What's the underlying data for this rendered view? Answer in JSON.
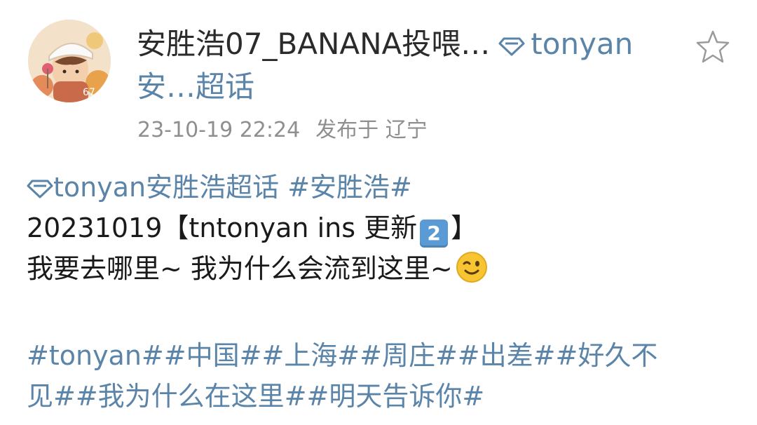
{
  "post": {
    "author_name": "安胜浩07_BANANA投喂…",
    "topic_inline": "tonyan",
    "topic_line2": "安…超话",
    "timestamp": "23-10-19 22:24",
    "location": "发布于 辽宁",
    "supertopic_link": "tonyan安胜浩超话",
    "hashtag1": "#安胜浩#",
    "title_date": "20231019",
    "title_bracket_open": "【tntonyan ins 更新",
    "title_num_badge": "2",
    "title_bracket_close": "】",
    "body_line": "我要去哪里~ 我为什么会流到这里~",
    "tags_line1": "#tonyan##中国##上海##周庄##出差##好久不",
    "tags_line2": "见##我为什么在这里##明天告诉你#"
  },
  "colors": {
    "link": "#5b84a9",
    "meta": "#8f8f8f",
    "text": "#1a1a1a"
  },
  "icons": {
    "star": "star-outline-icon",
    "diamond": "diamond-icon",
    "emoji": "winking-face-icon"
  }
}
